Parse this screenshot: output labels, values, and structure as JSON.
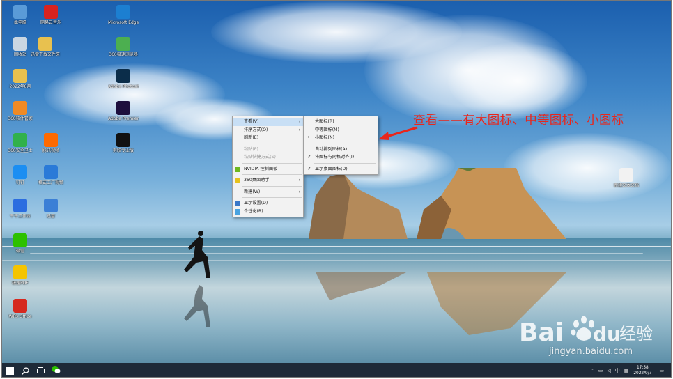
{
  "desktop": {
    "icons": [
      {
        "label": "此电脑",
        "icon": "computer-icon",
        "color": "#5a9bd8"
      },
      {
        "label": "网易云音乐",
        "icon": "netease-music-icon",
        "color": "#d8231f"
      },
      {
        "label": "Microsoft Edge",
        "icon": "edge-icon",
        "color": "#1c7fd1"
      },
      {
        "label": "回收站",
        "icon": "recycle-bin-icon",
        "color": "#c9d6e2"
      },
      {
        "label": "迅雷下载文件夹",
        "icon": "folder-icon",
        "color": "#e8c14f"
      },
      {
        "label": "360极速浏览器",
        "icon": "360-browser-icon",
        "color": "#4caf50"
      },
      {
        "label": "2022年8月",
        "icon": "folder-icon",
        "color": "#e8c14f"
      },
      {
        "label": "Adobe Photoshop",
        "icon": "photoshop-icon",
        "color": "#0b2d4a"
      },
      {
        "label": "360软件管家",
        "icon": "360-software-icon",
        "color": "#f08a24"
      },
      {
        "label": "Adobe Premiere",
        "icon": "premiere-icon",
        "color": "#1d0f3d"
      },
      {
        "label": "360安全卫士",
        "icon": "360-security-icon",
        "color": "#31b14a"
      },
      {
        "label": "腾讯视频",
        "icon": "tencent-video-icon",
        "color": "#ff6a00"
      },
      {
        "label": "剪映专业版",
        "icon": "capcut-icon",
        "color": "#111111"
      },
      {
        "label": "钉钉",
        "icon": "dingtalk-icon",
        "color": "#1b8ef2"
      },
      {
        "label": "格式工厂视频",
        "icon": "video-icon",
        "color": "#2a7ad8"
      },
      {
        "label": "千牛工作台",
        "icon": "qianniu-icon",
        "color": "#2b6de0"
      },
      {
        "label": "迅雷",
        "icon": "xunlei-icon",
        "color": "#3b7fd6"
      },
      {
        "label": "微信",
        "icon": "wechat-icon",
        "color": "#2dc100"
      },
      {
        "label": "极速PDF",
        "icon": "pdf-icon",
        "color": "#f5c400"
      },
      {
        "label": "WPS Office",
        "icon": "wps-icon",
        "color": "#d6291f"
      },
      {
        "label": "新建文本文档",
        "icon": "text-file-icon",
        "color": "#f2f2f2"
      }
    ]
  },
  "context_menu": {
    "items": [
      {
        "label": "查看(V)",
        "arrow": "›",
        "highlighted": true
      },
      {
        "label": "排序方式(O)",
        "arrow": "›"
      },
      {
        "label": "刷新(E)"
      },
      {
        "label": "粘贴(P)",
        "disabled": true
      },
      {
        "label": "粘贴快捷方式(S)",
        "disabled": true
      },
      {
        "label": "NVIDIA 控制面板",
        "icon": "nvidia-icon"
      },
      {
        "label": "360桌面助手",
        "icon": "360-desktop-icon",
        "arrow": "›"
      },
      {
        "label": "新建(W)",
        "arrow": "›"
      },
      {
        "label": "显示设置(D)",
        "icon": "display-icon"
      },
      {
        "label": "个性化(R)",
        "icon": "personalize-icon"
      }
    ]
  },
  "submenu": {
    "items": [
      {
        "label": "大图标(R)"
      },
      {
        "label": "中等图标(M)"
      },
      {
        "label": "小图标(N)",
        "mark": "•"
      },
      {
        "label": "自动排列图标(A)"
      },
      {
        "label": "将图标与网格对齐(I)",
        "mark": "✓"
      },
      {
        "label": "显示桌面图标(D)",
        "mark": "✓"
      }
    ]
  },
  "annotation": {
    "text": "查看——有大图标、中等图标、小图标",
    "color": "#e8261c"
  },
  "watermark": {
    "logo": "Bai",
    "paw": "du",
    "suffix": "经验",
    "url": "jingyan.baidu.com"
  },
  "taskbar": {
    "start_icon": "windows-start-icon",
    "search_icon": "search-icon",
    "taskview_icon": "task-view-icon",
    "pinned_icon": "wechat-icon",
    "time": "17:58",
    "date": "2022/9/7",
    "ime": "中",
    "tray_notice": "▭"
  }
}
